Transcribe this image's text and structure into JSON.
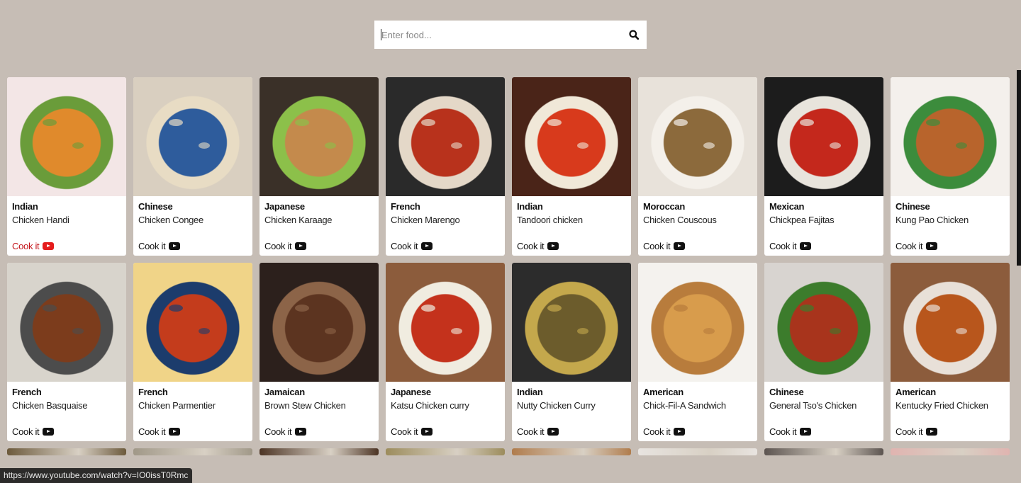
{
  "search": {
    "placeholder": "Enter food...",
    "value": "",
    "button_icon": "search-icon"
  },
  "cook_label": "Cook it",
  "cook_icon": "youtube-icon",
  "colors": {
    "background": "#c6bdb5",
    "card": "#ffffff",
    "hover_link": "#c4161c",
    "youtube_red": "#e51c1c"
  },
  "recipes": [
    {
      "cuisine": "Indian",
      "name": "Chicken Handi",
      "hovered": true,
      "img": [
        "#f3e6e6",
        "#e08a2c",
        "#6a9c3a"
      ]
    },
    {
      "cuisine": "Chinese",
      "name": "Chicken Congee",
      "img": [
        "#d9cfc0",
        "#2e5c9c",
        "#e8dcc4"
      ]
    },
    {
      "cuisine": "Japanese",
      "name": "Chicken Karaage",
      "img": [
        "#3a3028",
        "#c48a4c",
        "#8cc04a"
      ]
    },
    {
      "cuisine": "French",
      "name": "Chicken Marengo",
      "img": [
        "#2a2a2a",
        "#b8321c",
        "#e4d8c8"
      ]
    },
    {
      "cuisine": "Indian",
      "name": "Tandoori chicken",
      "img": [
        "#4a2418",
        "#d83a1c",
        "#f0e8d8"
      ]
    },
    {
      "cuisine": "Moroccan",
      "name": "Chicken Couscous",
      "img": [
        "#e8e2da",
        "#8c6a3c",
        "#f4f0ea"
      ]
    },
    {
      "cuisine": "Mexican",
      "name": "Chickpea Fajitas",
      "img": [
        "#1c1c1c",
        "#c4281c",
        "#e8e4dc"
      ]
    },
    {
      "cuisine": "Chinese",
      "name": "Kung Pao Chicken",
      "img": [
        "#f4f0ec",
        "#b8642c",
        "#3c8c3c"
      ]
    },
    {
      "cuisine": "French",
      "name": "Chicken Basquaise",
      "img": [
        "#d8d4cc",
        "#7c3c1c",
        "#4c4c4c"
      ]
    },
    {
      "cuisine": "French",
      "name": "Chicken Parmentier",
      "img": [
        "#f0d488",
        "#c43c1c",
        "#1c3c6c"
      ]
    },
    {
      "cuisine": "Jamaican",
      "name": "Brown Stew Chicken",
      "img": [
        "#2c201c",
        "#5c3420",
        "#8c6448"
      ]
    },
    {
      "cuisine": "Japanese",
      "name": "Katsu Chicken curry",
      "img": [
        "#8c5c3c",
        "#c4321c",
        "#f0ece0"
      ]
    },
    {
      "cuisine": "Indian",
      "name": "Nutty Chicken Curry",
      "img": [
        "#2c2c2c",
        "#6c5c2c",
        "#c4a84c"
      ]
    },
    {
      "cuisine": "American",
      "name": "Chick-Fil-A Sandwich",
      "img": [
        "#f4f2ee",
        "#d89c4c",
        "#b87c3c"
      ]
    },
    {
      "cuisine": "Chinese",
      "name": "General Tso's Chicken",
      "img": [
        "#d8d4d0",
        "#a8341c",
        "#3c7c2c"
      ]
    },
    {
      "cuisine": "American",
      "name": "Kentucky Fried Chicken",
      "img": [
        "#8c5c3c",
        "#b8561c",
        "#e8e0d8"
      ]
    }
  ],
  "partial_row_colors": [
    "#6c5a3c",
    "#a09888",
    "#4c3424",
    "#9c8c5c",
    "#b07c4c",
    "#e8e4e0",
    "#5c5450",
    "#e0b4b0"
  ],
  "status_bar": {
    "url": "https://www.youtube.com/watch?v=IO0issT0Rmc"
  }
}
